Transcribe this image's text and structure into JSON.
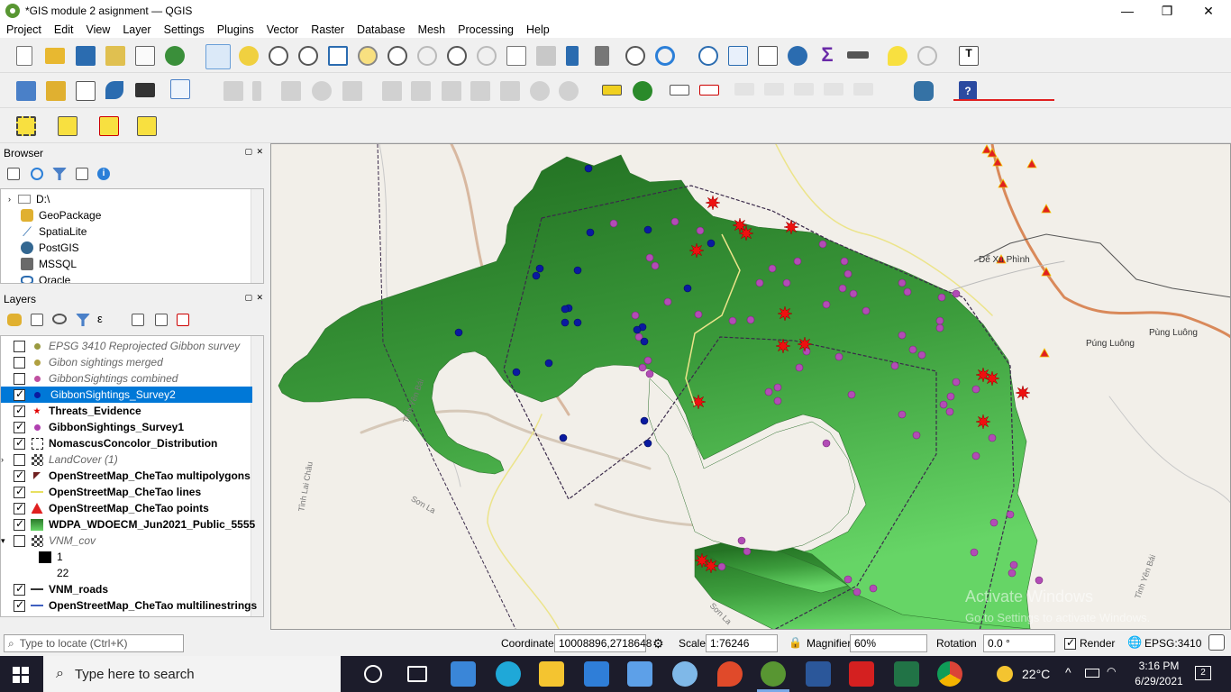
{
  "window": {
    "title": "*GIS module 2 asignment — QGIS",
    "controls": [
      "—",
      "❐",
      "✕"
    ]
  },
  "menu": [
    "Project",
    "Edit",
    "View",
    "Layer",
    "Settings",
    "Plugins",
    "Vector",
    "Raster",
    "Database",
    "Mesh",
    "Processing",
    "Help"
  ],
  "browser": {
    "title": "Browser",
    "items": [
      "D:\\",
      "GeoPackage",
      "SpatiaLite",
      "PostGIS",
      "MSSQL",
      "Oracle"
    ]
  },
  "layers": {
    "title": "Layers",
    "items": [
      {
        "label": "EPSG 3410 Reprojected Gibbon survey",
        "checked": false,
        "style": "ital",
        "symbol": "dot",
        "color": "#9a9a40"
      },
      {
        "label": "Gibon sightings merged",
        "checked": false,
        "style": "ital",
        "symbol": "dot",
        "color": "#b0a040"
      },
      {
        "label": "GibbonSightings combined",
        "checked": false,
        "style": "ital",
        "symbol": "dot",
        "color": "#c050a0"
      },
      {
        "label": "GibbonSightings_Survey2",
        "checked": true,
        "style": "sel",
        "symbol": "dot",
        "color": "#0a1aa0"
      },
      {
        "label": "Threats_Evidence",
        "checked": true,
        "style": "bold",
        "symbol": "star",
        "color": "#e00000"
      },
      {
        "label": "GibbonSightings_Survey1",
        "checked": true,
        "style": "bold",
        "symbol": "dot",
        "color": "#b040b0"
      },
      {
        "label": "NomascusConcolor_Distribution",
        "checked": true,
        "style": "bold",
        "symbol": "dash",
        "color": "#222222"
      },
      {
        "label": "LandCover (1)",
        "checked": false,
        "style": "ital",
        "symbol": "raster",
        "color": "#444444"
      },
      {
        "label": "OpenStreetMap_CheTao multipolygons",
        "checked": true,
        "style": "bold",
        "symbol": "poly",
        "color": "#702020"
      },
      {
        "label": "OpenStreetMap_CheTao lines",
        "checked": true,
        "style": "bold",
        "symbol": "line",
        "color": "#e8e060"
      },
      {
        "label": "OpenStreetMap_CheTao points",
        "checked": true,
        "style": "bold",
        "symbol": "tri",
        "color": "#e02020"
      },
      {
        "label": "WDPA_WDOECM_Jun2021_Public_5555",
        "checked": true,
        "style": "bold",
        "symbol": "fill",
        "color": "#3fa03f"
      },
      {
        "label": "VNM_cov",
        "checked": false,
        "style": "ital",
        "symbol": "raster",
        "color": "#444444"
      },
      {
        "label": "1",
        "checked": null,
        "style": "sub",
        "symbol": "black",
        "color": "#000000"
      },
      {
        "label": "22",
        "checked": null,
        "style": "sub",
        "symbol": "none",
        "color": "#ffffff"
      },
      {
        "label": "VNM_roads",
        "checked": true,
        "style": "bold",
        "symbol": "line",
        "color": "#333333"
      },
      {
        "label": "OpenStreetMap_CheTao multilinestrings",
        "checked": true,
        "style": "bold",
        "symbol": "line",
        "color": "#4060c0"
      }
    ]
  },
  "map": {
    "labels": [
      "Dế Xu Phình",
      "Púng Luông",
      "Pùng Luông",
      "Tỉnh Yên Bái",
      "Tỉnh Yên Bái",
      "Sơn La",
      "Sơn La",
      "Tỉnh Lai Châu"
    ],
    "watermark1": "Activate Windows",
    "watermark2": "Go to Settings to activate Windows."
  },
  "status": {
    "locate_placeholder": "Type to locate (Ctrl+K)",
    "coordinate_label": "Coordinate",
    "coordinate_value": "10008896,2718648",
    "scale_label": "Scale",
    "scale_value": "1:76246",
    "magnifier_label": "Magnifier",
    "magnifier_value": "60%",
    "rotation_label": "Rotation",
    "rotation_value": "0.0 °",
    "render_label": "Render",
    "crs": "EPSG:3410"
  },
  "taskbar": {
    "search_placeholder": "Type here to search",
    "weather": "22°C",
    "time": "3:16 PM",
    "date": "6/29/2021",
    "notifications": "2"
  }
}
